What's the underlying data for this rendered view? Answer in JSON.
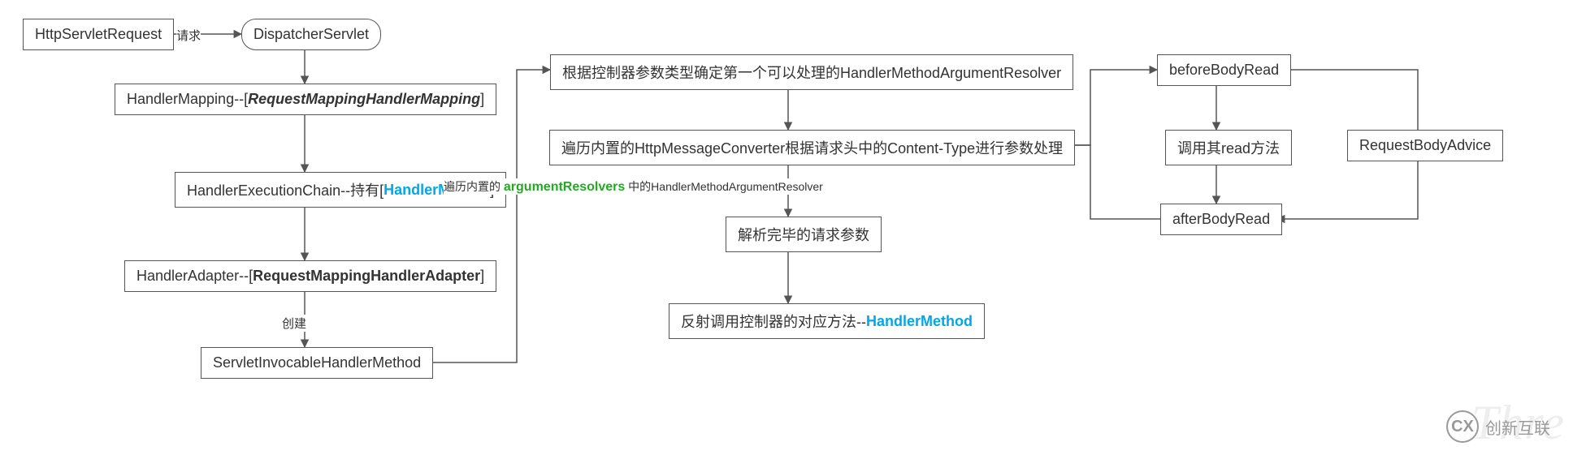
{
  "nodes": {
    "httpReq": "HttpServletRequest",
    "dispatcher": "DispatcherServlet",
    "handlerMapping_pre": "HandlerMapping--[",
    "handlerMapping_em": "RequestMappingHandlerMapping",
    "handlerMapping_post": "]",
    "execChain_pre": "HandlerExecutionChain--持有[",
    "execChain_blue": "HandlerMethod",
    "execChain_post": "]",
    "handlerAdapter_pre": "HandlerAdapter--[",
    "handlerAdapter_bold": "RequestMappingHandlerAdapter",
    "handlerAdapter_post": "]",
    "invocable": "ServletInvocableHandlerMethod",
    "resolverPick": "根据控制器参数类型确定第一个可以处理的HandlerMethodArgumentResolver",
    "msgConverter": "遍历内置的HttpMessageConverter根据请求头中的Content-Type进行参数处理",
    "parsed": "解析完毕的请求参数",
    "invoke_pre": "反射调用控制器的对应方法--",
    "invoke_blue": "HandlerMethod",
    "beforeRead": "beforeBodyRead",
    "callRead": "调用其read方法",
    "afterRead": "afterBodyRead",
    "reqBodyAdvice": "RequestBodyAdvice"
  },
  "edgeLabels": {
    "request": "请求",
    "create": "创建",
    "traverse_pre": "遍历内置的",
    "traverse_green": "argumentResolvers",
    "traverse_post": "中的HandlerMethodArgumentResolver"
  },
  "watermark": {
    "logo": "CX",
    "text": "创新互联"
  },
  "ghost": "Thre"
}
